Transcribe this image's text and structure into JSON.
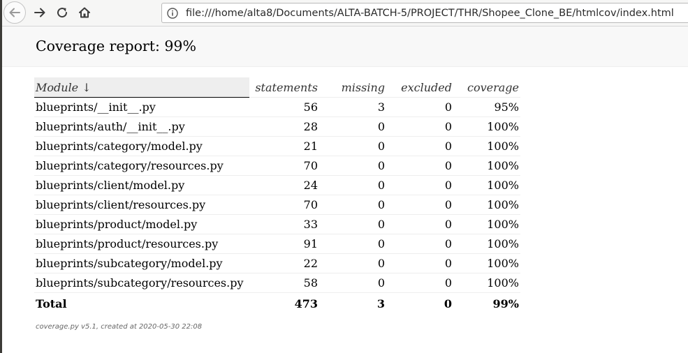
{
  "browser": {
    "url": "file:///home/alta8/Documents/ALTA-BATCH-5/PROJECT/THR/Shopee_Clone_BE/htmlcov/index.html",
    "nav_icons": [
      "back-arrow-icon",
      "forward-arrow-icon",
      "reload-icon",
      "home-icon",
      "info-icon"
    ]
  },
  "report": {
    "title": "Coverage report: 99%",
    "columns": [
      "Module ↓",
      "statements",
      "missing",
      "excluded",
      "coverage"
    ],
    "rows": [
      {
        "module": "blueprints/__init__.py",
        "statements": "56",
        "missing": "3",
        "excluded": "0",
        "coverage": "95%"
      },
      {
        "module": "blueprints/auth/__init__.py",
        "statements": "28",
        "missing": "0",
        "excluded": "0",
        "coverage": "100%"
      },
      {
        "module": "blueprints/category/model.py",
        "statements": "21",
        "missing": "0",
        "excluded": "0",
        "coverage": "100%"
      },
      {
        "module": "blueprints/category/resources.py",
        "statements": "70",
        "missing": "0",
        "excluded": "0",
        "coverage": "100%"
      },
      {
        "module": "blueprints/client/model.py",
        "statements": "24",
        "missing": "0",
        "excluded": "0",
        "coverage": "100%"
      },
      {
        "module": "blueprints/client/resources.py",
        "statements": "70",
        "missing": "0",
        "excluded": "0",
        "coverage": "100%"
      },
      {
        "module": "blueprints/product/model.py",
        "statements": "33",
        "missing": "0",
        "excluded": "0",
        "coverage": "100%"
      },
      {
        "module": "blueprints/product/resources.py",
        "statements": "91",
        "missing": "0",
        "excluded": "0",
        "coverage": "100%"
      },
      {
        "module": "blueprints/subcategory/model.py",
        "statements": "22",
        "missing": "0",
        "excluded": "0",
        "coverage": "100%"
      },
      {
        "module": "blueprints/subcategory/resources.py",
        "statements": "58",
        "missing": "0",
        "excluded": "0",
        "coverage": "100%"
      }
    ],
    "total": {
      "label": "Total",
      "statements": "473",
      "missing": "3",
      "excluded": "0",
      "coverage": "99%"
    },
    "footer": "coverage.py v5.1, created at 2020-05-30 22:08"
  },
  "colors": {
    "toolbar_bg": "#f6f6f5",
    "header_bg": "#f8f8f8",
    "sorted_header_bg": "#eeeeee",
    "icon": "#3c3c3c"
  }
}
